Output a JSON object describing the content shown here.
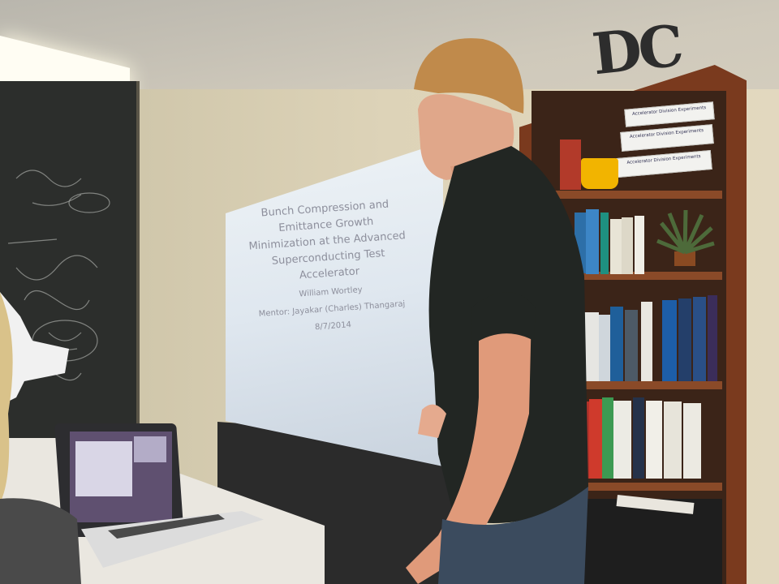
{
  "slide": {
    "title": "Bunch Compression and Emittance Growth Minimization at the Advanced Superconducting Test Accelerator",
    "author": "William Wortley",
    "mentor": "Mentor: Jayakar (Charles) Thangaraj",
    "date": "8/7/2014"
  },
  "shelf_labels": [
    "Accelerator Division Experiments",
    "Accelerator Division Experiments",
    "Accelerator Division Experiments"
  ],
  "wall_sign": "DC"
}
